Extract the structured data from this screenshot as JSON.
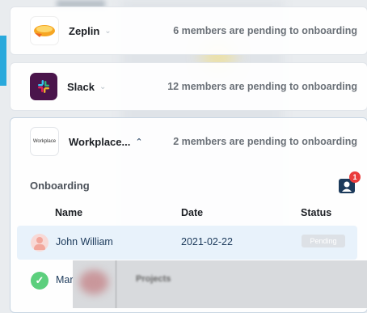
{
  "apps": [
    {
      "name": "Zeplin",
      "pending": "6 members are pending to onboarding"
    },
    {
      "name": "Slack",
      "pending": "12 members are pending to onboarding"
    },
    {
      "name": "Workplace...",
      "pending": "2 members are pending to onboarding"
    }
  ],
  "workplace_logo_text": "Workplace",
  "onboarding": {
    "title": "Onboarding",
    "badge_count": "1",
    "columns": [
      "Name",
      "Date",
      "Status"
    ],
    "rows": [
      {
        "name": "John William",
        "date": "2021-02-22",
        "status": "Pending"
      },
      {
        "name": "Mar"
      }
    ]
  },
  "overlay": {
    "title": "Projects"
  },
  "colors": {
    "accent": "#29a9dc",
    "slack": "#4a154b",
    "badge": "#ea3c3c",
    "check": "#5ccf7d"
  }
}
